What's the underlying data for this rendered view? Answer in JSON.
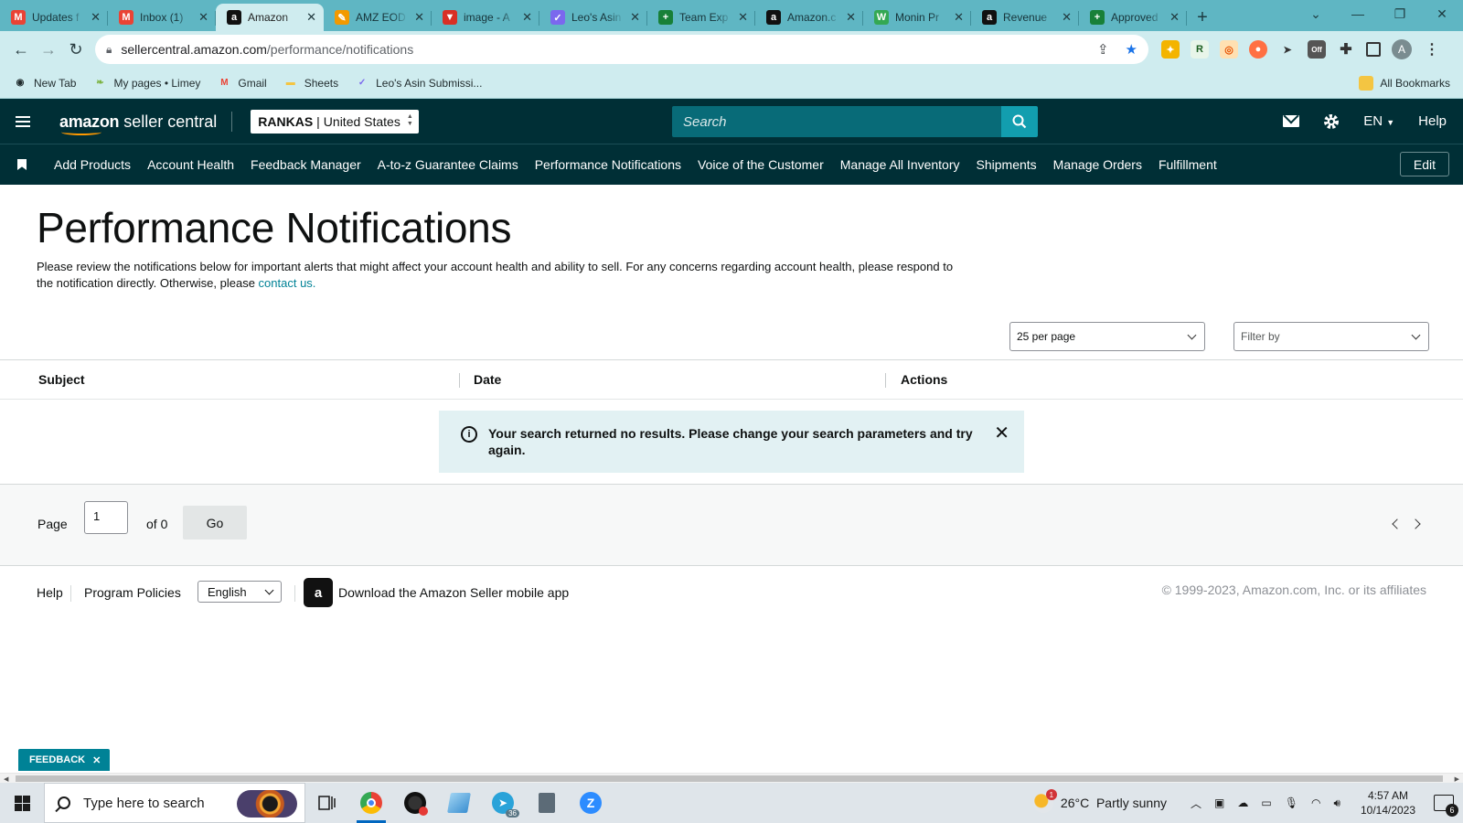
{
  "browser": {
    "tabs": [
      {
        "title": "Updates f",
        "favicon": "gmail-icon",
        "color": "#ea4335",
        "glyph": "M"
      },
      {
        "title": "Inbox (1)",
        "favicon": "gmail-icon",
        "color": "#ea4335",
        "glyph": "M"
      },
      {
        "title": "Amazon",
        "favicon": "amazon-icon",
        "color": "#111111",
        "glyph": "a",
        "active": true
      },
      {
        "title": "AMZ EOD",
        "favicon": "pencil-icon",
        "color": "#f29900",
        "glyph": "✎"
      },
      {
        "title": "image - A",
        "favicon": "vivaldi-icon",
        "color": "#d93025",
        "glyph": "▼"
      },
      {
        "title": "Leo's Asin",
        "favicon": "clickup-icon",
        "color": "#7b68ee",
        "glyph": "✓"
      },
      {
        "title": "Team Exp",
        "favicon": "sheets-icon",
        "color": "#188038",
        "glyph": "+"
      },
      {
        "title": "Amazon.c",
        "favicon": "amazon-icon",
        "color": "#111111",
        "glyph": "a"
      },
      {
        "title": "Monin Pr",
        "favicon": "monin-icon",
        "color": "#34a853",
        "glyph": "W"
      },
      {
        "title": "Revenue",
        "favicon": "amazon-icon",
        "color": "#111111",
        "glyph": "a"
      },
      {
        "title": "Approved",
        "favicon": "sheets-icon",
        "color": "#188038",
        "glyph": "+"
      }
    ],
    "url_host": "sellercentral.amazon.com",
    "url_path": "/performance/notifications",
    "bookmarks": [
      {
        "label": "New Tab",
        "icon": "globe-icon",
        "color": "#1f2a2c",
        "glyph": "◉"
      },
      {
        "label": "My pages • Limey",
        "icon": "limey-icon",
        "color": "#7cb342",
        "glyph": "❧"
      },
      {
        "label": "Gmail",
        "icon": "gmail-icon",
        "color": "#ea4335",
        "glyph": "M"
      },
      {
        "label": "Sheets",
        "icon": "folder-icon",
        "color": "#f4c542",
        "glyph": "▬"
      },
      {
        "label": "Leo's Asin Submissi...",
        "icon": "clickup-icon",
        "color": "#7b68ee",
        "glyph": "✓"
      }
    ],
    "all_bookmarks": "All Bookmarks",
    "avatar_letter": "A"
  },
  "header": {
    "logo_amazon": "amazon",
    "logo_rest": " seller central",
    "account_name": "RANKAS",
    "account_separator": "|",
    "account_region": "United States",
    "search_placeholder": "Search",
    "language": "EN",
    "help": "Help"
  },
  "nav": {
    "items": [
      "Add Products",
      "Account Health",
      "Feedback Manager",
      "A-to-z Guarantee Claims",
      "Performance Notifications",
      "Voice of the Customer",
      "Manage All Inventory",
      "Shipments",
      "Manage Orders",
      "Fulfillment"
    ],
    "edit": "Edit"
  },
  "main": {
    "title": "Performance Notifications",
    "intro_text": "Please review the notifications below for important alerts that might affect your account health and ability to sell. For any concerns regarding account health, please respond to the notification directly. Otherwise, please ",
    "intro_link": "contact us.",
    "per_page": "25 per page",
    "filter_placeholder": "Filter by",
    "columns": [
      "Subject",
      "Date",
      "Actions"
    ],
    "alert_message": "Your search returned no results. Please change your search parameters and try again.",
    "pager": {
      "page_label": "Page",
      "page_value": "1",
      "of_label": "of 0",
      "go": "Go"
    }
  },
  "footer": {
    "help": "Help",
    "program_policies": "Program Policies",
    "language": "English",
    "app_text": "Download the Amazon Seller mobile app",
    "copyright": "© 1999-2023, Amazon.com, Inc. or its affiliates"
  },
  "feedback": {
    "label": "FEEDBACK",
    "close": "✕"
  },
  "taskbar": {
    "search_placeholder": "Type here to search",
    "weather_temp": "26°C",
    "weather_desc": "Partly sunny",
    "time": "4:57 AM",
    "date": "10/14/2023",
    "notification_count": "6",
    "telegram_badge": "36"
  },
  "colors": {
    "header_bg": "#002f36",
    "search_bg": "#086b78",
    "search_button": "#129eaf",
    "link": "#008296",
    "alert_bg": "#e2f1f3",
    "tabstrip": "#5fb6c3"
  }
}
